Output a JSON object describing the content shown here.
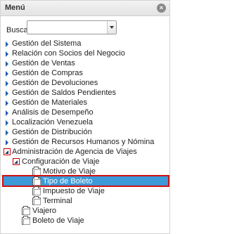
{
  "header": {
    "title": "Menú",
    "close_icon": "close-icon"
  },
  "search": {
    "label": "Buscar:",
    "value": "",
    "placeholder": ""
  },
  "tree": {
    "top_items": [
      "Gestión del Sistema",
      "Relación con Socios del Negocio",
      "Gestión de Ventas",
      "Gestión de Compras",
      "Gestión de Devoluciones",
      "Gestión de Saldos Pendientes",
      "Gestión de Materiales",
      "Análisis de Desempeño",
      "Localización Venezuela",
      "Gestión de Distribución",
      "Gestión de Recursos Humanos y Nómina"
    ],
    "expanded_item": "Administración de Agencia de Viajes",
    "subgroup": "Configuración de Viaje",
    "subgroup_items": [
      "Motivo de Viaje",
      "Tipo de Boleto",
      "Impuesto de Viaje",
      "Terminal"
    ],
    "selected_item": "Tipo de Boleto",
    "sibling_items": [
      "Viajero",
      "Boleto de Viaje"
    ]
  },
  "colors": {
    "selection": "#3c9ad9",
    "highlight_border": "#d01111",
    "arrow": "#1f5fa8"
  }
}
